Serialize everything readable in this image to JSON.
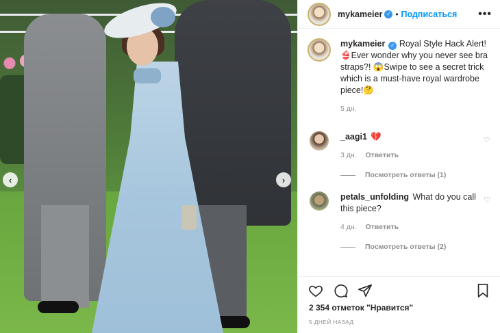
{
  "post": {
    "header": {
      "username": "mykameier",
      "separator": "•",
      "follow_label": "Подписаться",
      "more_label": "•••"
    },
    "caption": {
      "username": "mykameier",
      "text": "Royal Style Hack Alert! 👙Ever wonder why you never see bra straps?! 😱Swipe to see a secret trick which is a must-have royal wardrobe piece!🤔",
      "time": "5 дн."
    },
    "comments": [
      {
        "username": "_aagi1",
        "text": "💔",
        "time": "3 дн.",
        "reply_label": "Ответить",
        "view_replies": "Посмотреть ответы (1)"
      },
      {
        "username": "petals_unfolding",
        "text": "What do you call this piece?",
        "time": "4 дн.",
        "reply_label": "Ответить",
        "view_replies": "Посмотреть ответы (2)"
      }
    ],
    "likes": "2 354 отметок \"Нравится\"",
    "date": "5 ДНЕЙ НАЗАД"
  },
  "icons": {
    "verified": "verified-badge-icon",
    "like": "heart-icon",
    "comment": "comment-icon",
    "share": "share-icon",
    "save": "bookmark-icon",
    "carousel_prev": "chevron-left-icon",
    "carousel_next": "chevron-right-icon"
  },
  "colors": {
    "accent": "#0095f6",
    "verified": "#3897f0",
    "muted": "#8e8e8e",
    "text": "#262626"
  }
}
